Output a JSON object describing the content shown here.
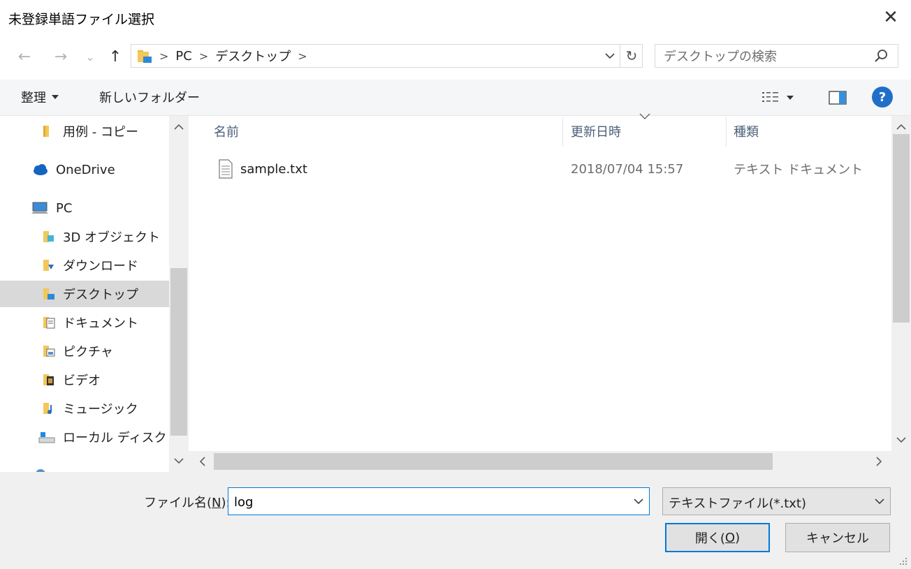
{
  "window": {
    "title": "未登録単語ファイル選択",
    "close_label": "✕"
  },
  "nav": {
    "back_icon": "←",
    "forward_icon": "→",
    "recent_icon": "⌄",
    "up_icon": "↑",
    "breadcrumb": [
      "PC",
      "デスクトップ"
    ],
    "refresh_icon": "↻",
    "search_placeholder": "デスクトップの検索"
  },
  "toolbar": {
    "organize": "整理",
    "new_folder": "新しいフォルダー",
    "help": "?"
  },
  "sidebar": {
    "items": [
      {
        "label": "用例 - コピー",
        "icon": "folder-icon"
      },
      {
        "label": "OneDrive",
        "icon": "cloud-icon"
      },
      {
        "label": "PC",
        "icon": "computer-icon"
      },
      {
        "label": "3D オブジェクト",
        "icon": "3d-objects-icon"
      },
      {
        "label": "ダウンロード",
        "icon": "download-icon"
      },
      {
        "label": "デスクトップ",
        "icon": "desktop-icon",
        "selected": true
      },
      {
        "label": "ドキュメント",
        "icon": "documents-icon"
      },
      {
        "label": "ピクチャ",
        "icon": "pictures-icon"
      },
      {
        "label": "ビデオ",
        "icon": "videos-icon"
      },
      {
        "label": "ミュージック",
        "icon": "music-icon"
      },
      {
        "label": "ローカル ディスク (C",
        "icon": "drive-icon"
      }
    ]
  },
  "columns": {
    "name": "名前",
    "modified": "更新日時",
    "type": "種類"
  },
  "files": [
    {
      "name": "sample.txt",
      "modified": "2018/07/04 15:57",
      "type": "テキスト ドキュメント",
      "icon": "text-file-icon"
    }
  ],
  "footer": {
    "filename_label": "ファイル名(",
    "filename_accel": "N",
    "filename_label_end": "):",
    "filename_value": "log",
    "filetype_value": "テキストファイル(*.txt)",
    "open_label": "開く(",
    "open_accel": "O",
    "open_label_end": ")",
    "cancel_label": "キャンセル"
  },
  "colors": {
    "accent": "#0078d7",
    "selection": "#d9d9d9",
    "toolbar_bg": "#f5f6f7",
    "header_text": "#4c607a",
    "help_bg": "#1f6fc9"
  }
}
